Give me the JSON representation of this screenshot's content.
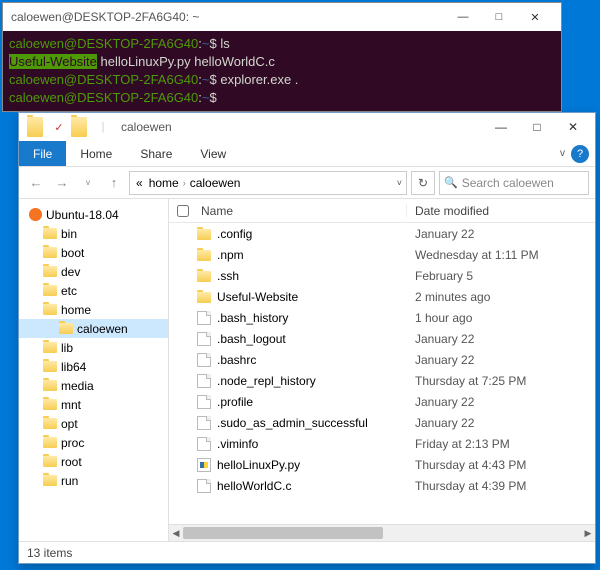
{
  "terminal": {
    "title": "caloewen@DESKTOP-2FA6G40: ~",
    "prompt_user_host": "caloewen@DESKTOP-2FA6G40",
    "prompt_path": "~",
    "prompt_sep": ":",
    "prompt_end": "$",
    "cmd1": "ls",
    "ls_out_hl": "Useful-Website",
    "ls_out_rest": "  helloLinuxPy.py  helloWorldC.c",
    "cmd2": "explorer.exe .",
    "win_min": "—",
    "win_max": "□",
    "win_close": "✕"
  },
  "explorer": {
    "qat_folder": "▣",
    "qat_check": "✓",
    "title": "caloewen",
    "win_min": "—",
    "win_max": "□",
    "win_close": "✕",
    "file_tab": "File",
    "tabs": [
      "Home",
      "Share",
      "View"
    ],
    "chev": "v",
    "help": "?",
    "nav_back": "←",
    "nav_fwd": "→",
    "nav_up": "↑",
    "nav_hist": "˅",
    "path_prefix": "«",
    "crumbs": [
      "home",
      "caloewen"
    ],
    "crumb_sep": "›",
    "path_drop": "˅",
    "refresh": "↻",
    "search_placeholder": "Search caloewen",
    "tree_root": "Ubuntu-18.04",
    "tree": [
      "bin",
      "boot",
      "dev",
      "etc",
      "home",
      "lib",
      "lib64",
      "media",
      "mnt",
      "opt",
      "proc",
      "root",
      "run"
    ],
    "tree_sub": "caloewen",
    "col_name": "Name",
    "col_date": "Date modified",
    "files": [
      {
        "n": ".config",
        "t": "folder",
        "d": "January 22"
      },
      {
        "n": ".npm",
        "t": "folder",
        "d": "Wednesday at 1:11 PM"
      },
      {
        "n": ".ssh",
        "t": "folder",
        "d": "February 5"
      },
      {
        "n": "Useful-Website",
        "t": "folder",
        "d": "2 minutes ago"
      },
      {
        "n": ".bash_history",
        "t": "file",
        "d": "1 hour ago"
      },
      {
        "n": ".bash_logout",
        "t": "file",
        "d": "January 22"
      },
      {
        "n": ".bashrc",
        "t": "file",
        "d": "January 22"
      },
      {
        "n": ".node_repl_history",
        "t": "file",
        "d": "Thursday at 7:25 PM"
      },
      {
        "n": ".profile",
        "t": "file",
        "d": "January 22"
      },
      {
        "n": ".sudo_as_admin_successful",
        "t": "file",
        "d": "January 22"
      },
      {
        "n": ".viminfo",
        "t": "file",
        "d": "Friday at 2:13 PM"
      },
      {
        "n": "helloLinuxPy.py",
        "t": "py",
        "d": "Thursday at 4:43 PM"
      },
      {
        "n": "helloWorldC.c",
        "t": "file",
        "d": "Thursday at 4:39 PM"
      }
    ],
    "status": "13 items"
  }
}
